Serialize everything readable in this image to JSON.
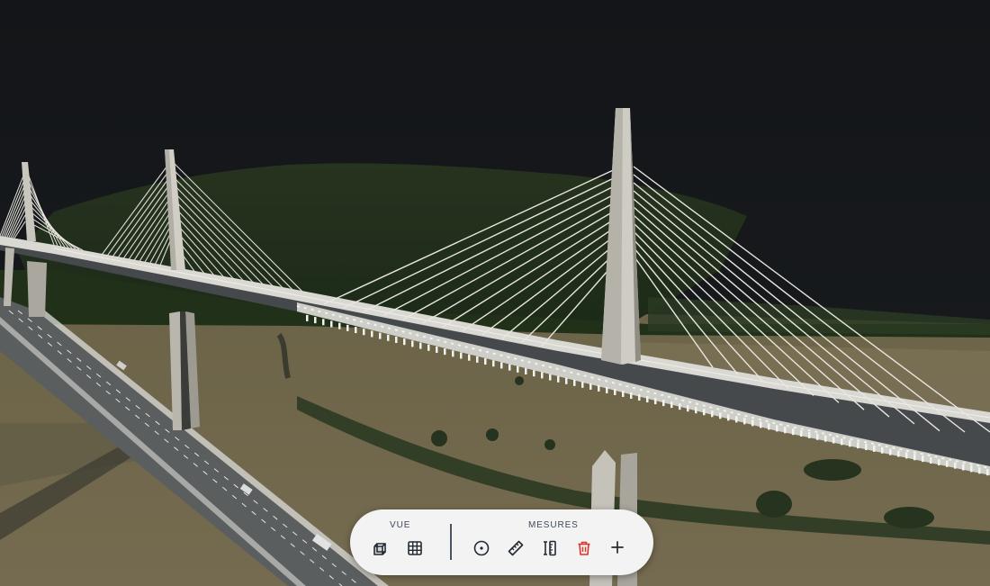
{
  "scene": {
    "subject": "cable-stayed-bridge-point-cloud",
    "sky_color": "#111315"
  },
  "toolbar": {
    "view_group_label": "VUE",
    "measures_group_label": "MESURES",
    "view_buttons": [
      {
        "icon": "cube-icon",
        "name": "3d-view-button"
      },
      {
        "icon": "grid-icon",
        "name": "grid-view-button"
      }
    ],
    "measure_buttons": [
      {
        "icon": "point-target-icon",
        "name": "point-measure-button"
      },
      {
        "icon": "ruler-icon",
        "name": "distance-measure-button"
      },
      {
        "icon": "height-measure-icon",
        "name": "height-measure-button"
      },
      {
        "icon": "trash-icon",
        "name": "delete-measures-button",
        "color": "#e0312b"
      },
      {
        "icon": "plus-icon",
        "name": "add-measure-button"
      }
    ]
  }
}
